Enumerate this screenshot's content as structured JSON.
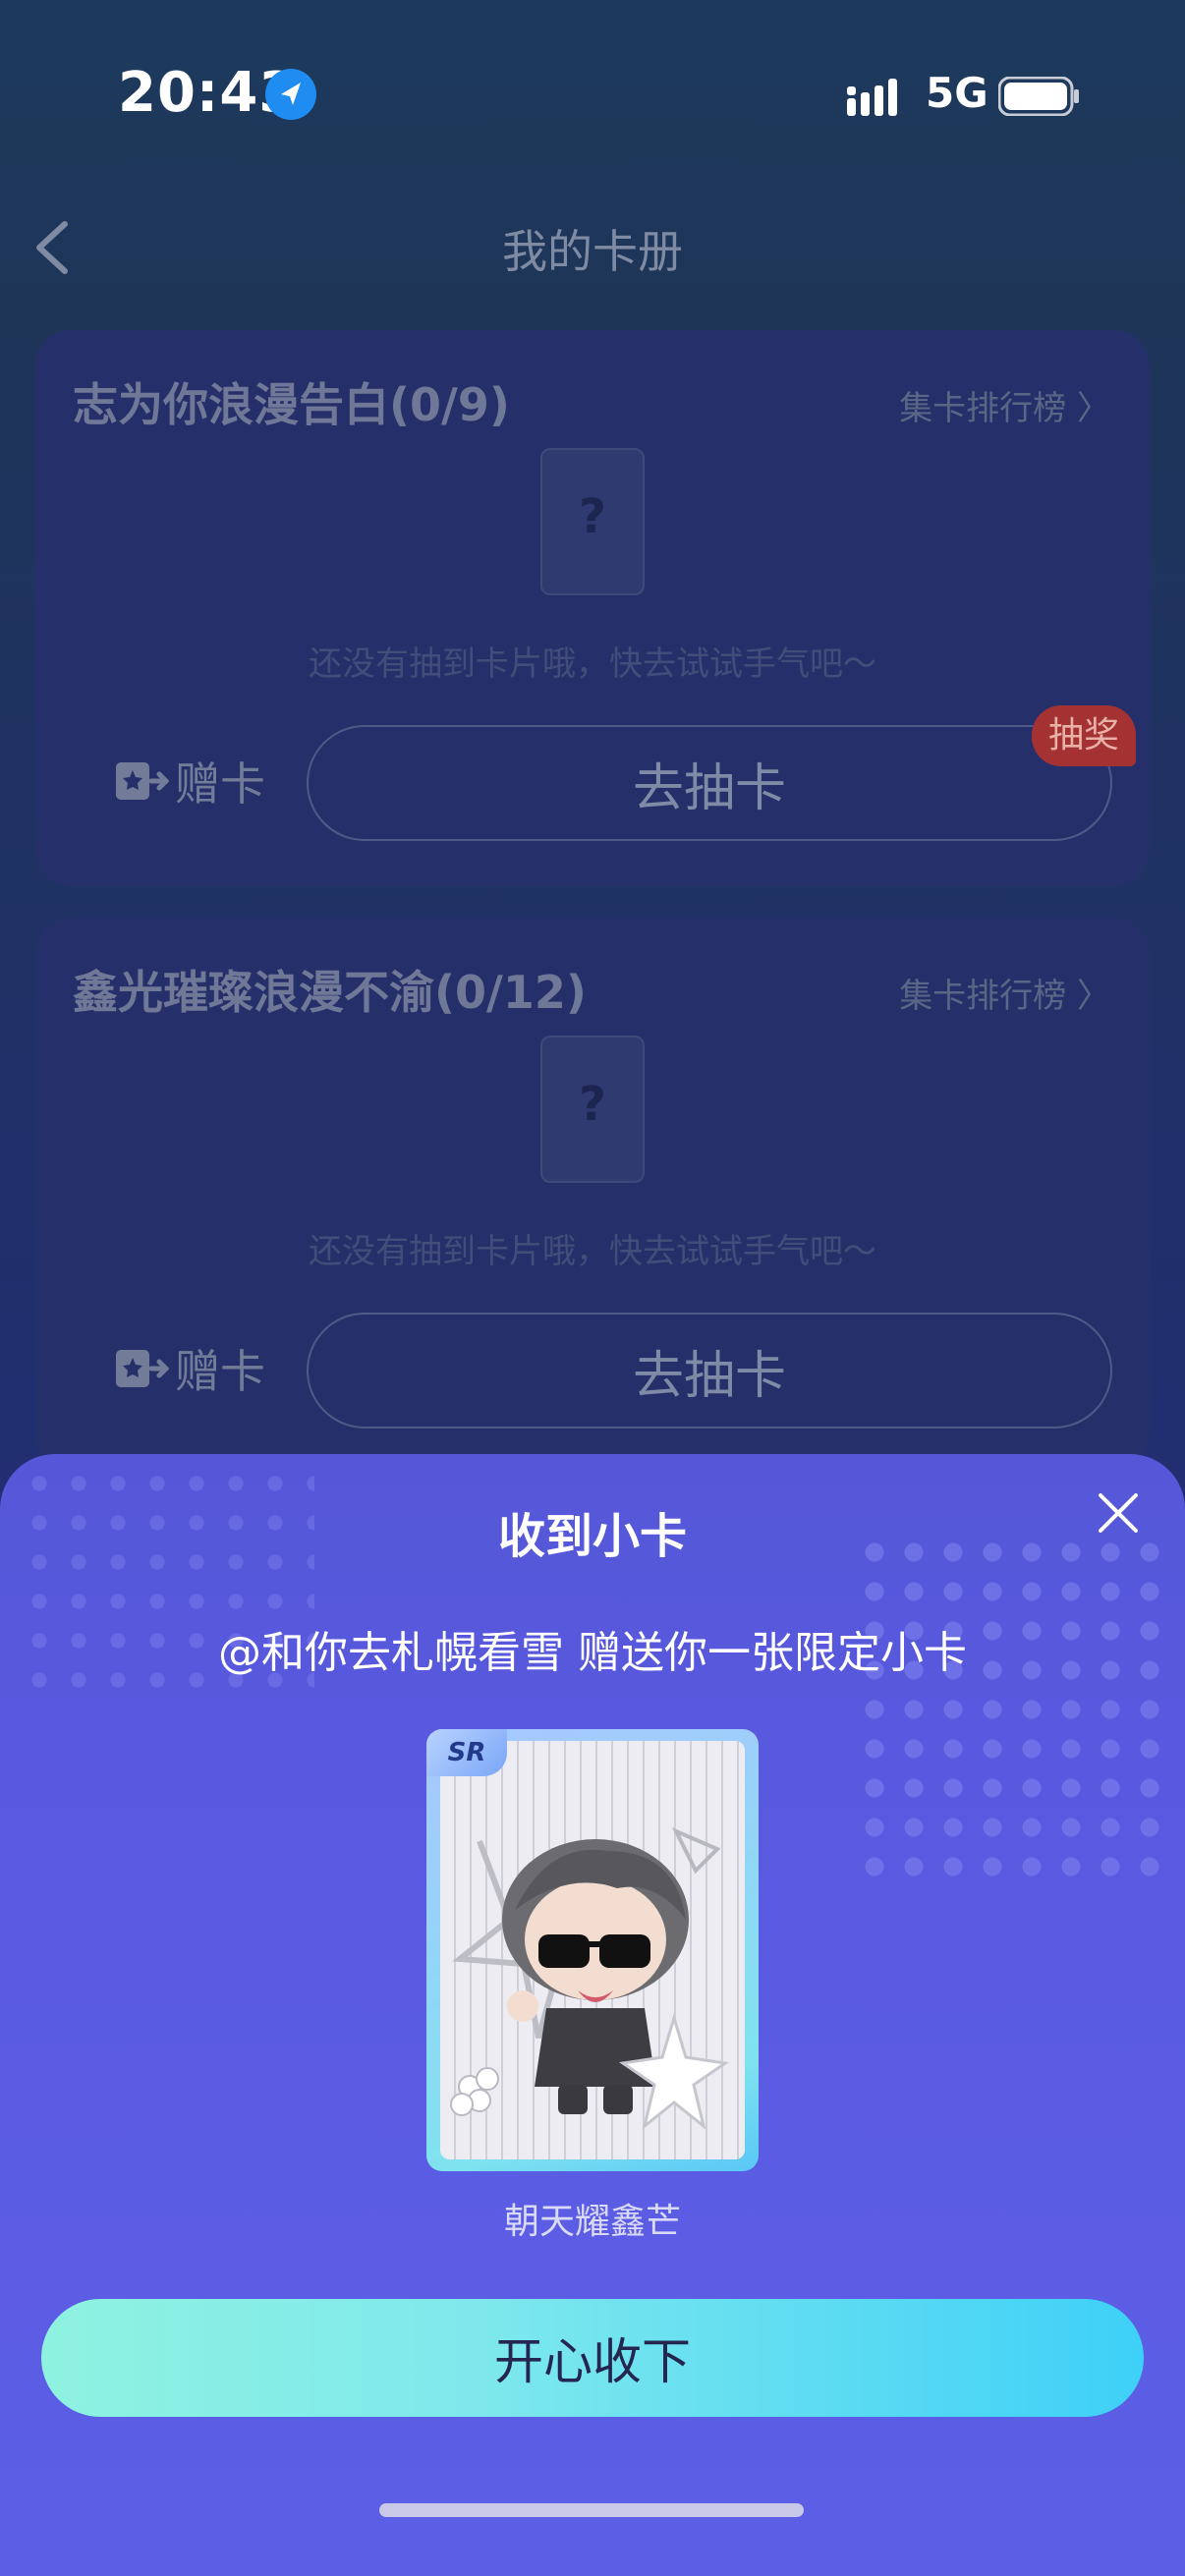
{
  "status_bar": {
    "time": "20:43",
    "network": "5G"
  },
  "header": {
    "title": "我的卡册"
  },
  "albums": [
    {
      "title": "志为你浪漫告白(0/9)",
      "rank_link": "集卡排行榜 〉",
      "placeholder": "?",
      "empty_hint": "还没有抽到卡片哦，快去试试手气吧～",
      "gift_label": "赠卡",
      "draw_label": "去抽卡",
      "badge": "抽奖"
    },
    {
      "title": "鑫光璀璨浪漫不渝(0/12)",
      "rank_link": "集卡排行榜 〉",
      "placeholder": "?",
      "empty_hint": "还没有抽到卡片哦，快去试试手气吧～",
      "gift_label": "赠卡",
      "draw_label": "去抽卡"
    }
  ],
  "modal": {
    "title": "收到小卡",
    "message": "@和你去札幌看雪 赠送你一张限定小卡",
    "card": {
      "rarity": "SR",
      "name": "朝天耀鑫芒"
    },
    "accept_label": "开心收下"
  },
  "icons": {
    "location": "location-arrow-icon",
    "signal": "signal-icon",
    "battery": "battery-icon",
    "back": "back-chevron-icon",
    "gift": "gift-card-icon",
    "close": "close-icon"
  },
  "colors": {
    "accent_start": "#8ff2e0",
    "accent_end": "#3ed0f8",
    "modal_bg": "#5a5ae2",
    "badge": "#a43232"
  }
}
